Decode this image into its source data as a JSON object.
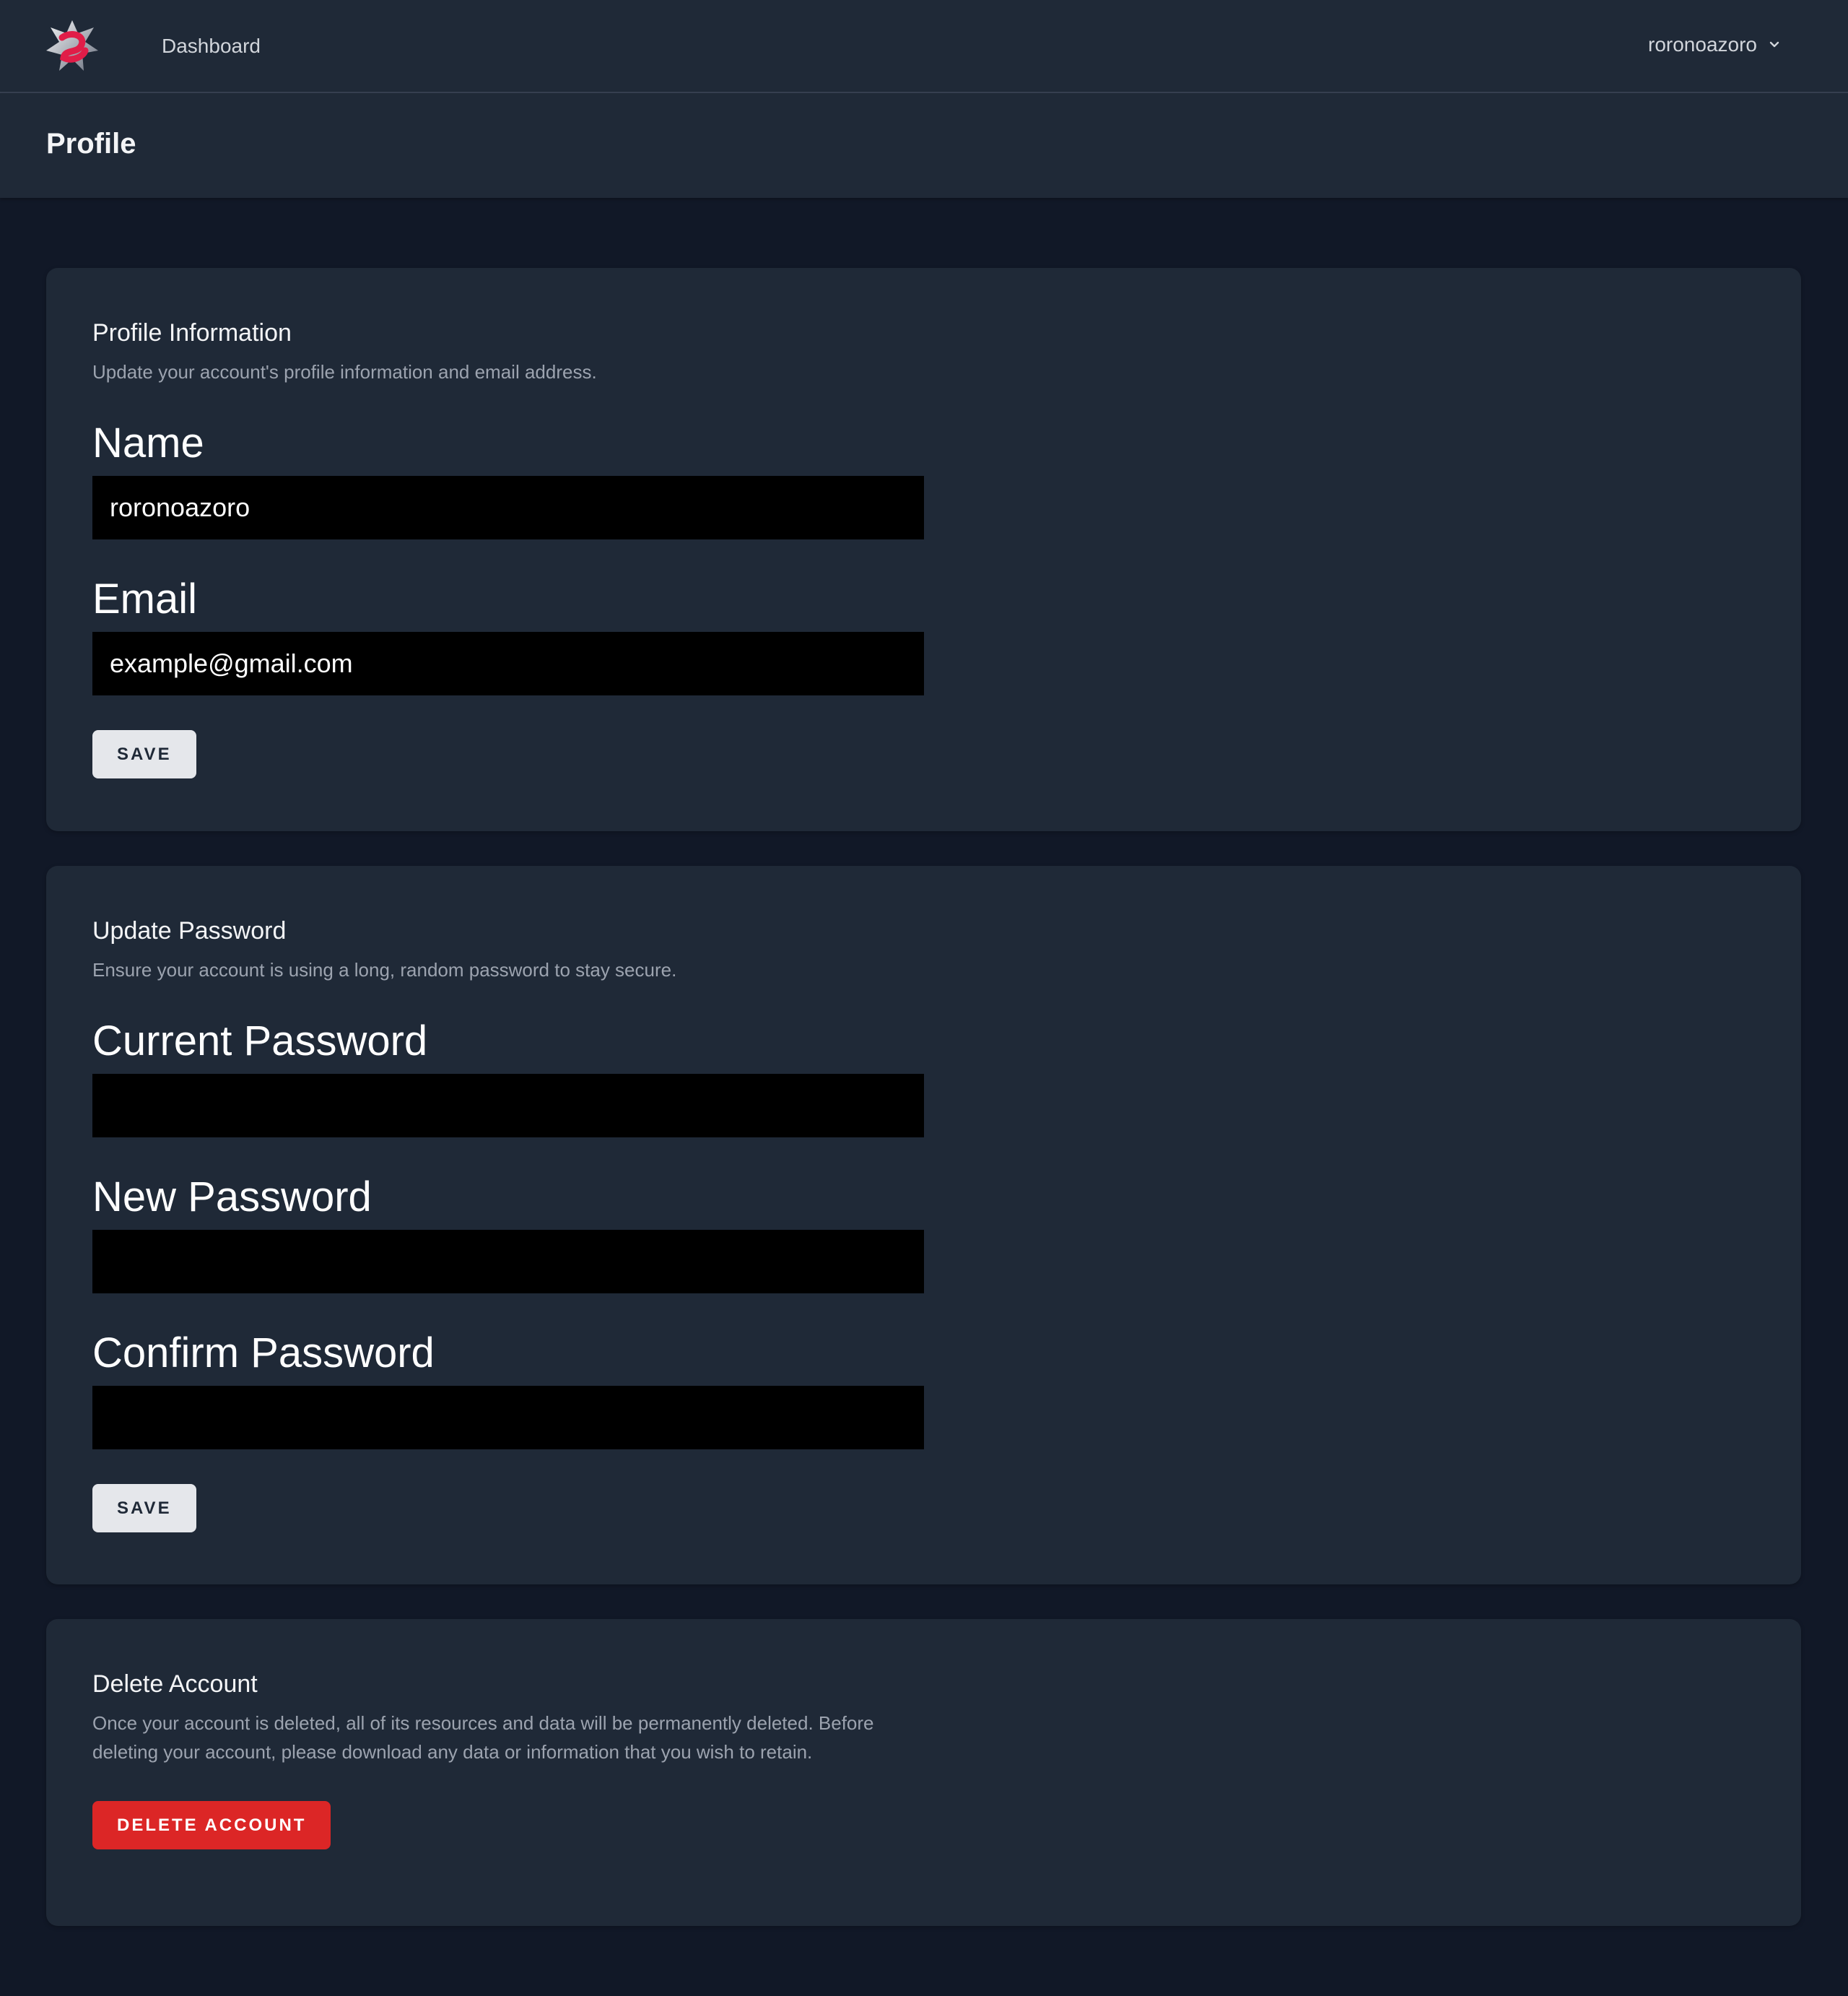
{
  "nav": {
    "dashboard_label": "Dashboard",
    "user_name": "roronoazoro"
  },
  "header": {
    "title": "Profile"
  },
  "profile_info": {
    "title": "Profile Information",
    "description": "Update your account's profile information and email address.",
    "name_label": "Name",
    "name_value": "roronoazoro",
    "email_label": "Email",
    "email_value": "example@gmail.com",
    "save_label": "SAVE"
  },
  "update_password": {
    "title": "Update Password",
    "description": "Ensure your account is using a long, random password to stay secure.",
    "current_label": "Current Password",
    "new_label": "New Password",
    "confirm_label": "Confirm Password",
    "save_label": "SAVE"
  },
  "delete_account": {
    "title": "Delete Account",
    "description": "Once your account is deleted, all of its resources and data will be permanently deleted. Before deleting your account, please download any data or information that you wish to retain.",
    "button_label": "DELETE ACCOUNT"
  },
  "colors": {
    "background": "#111827",
    "card": "#1f2937",
    "danger": "#dc2626",
    "logo_accent": "#e11d48"
  }
}
